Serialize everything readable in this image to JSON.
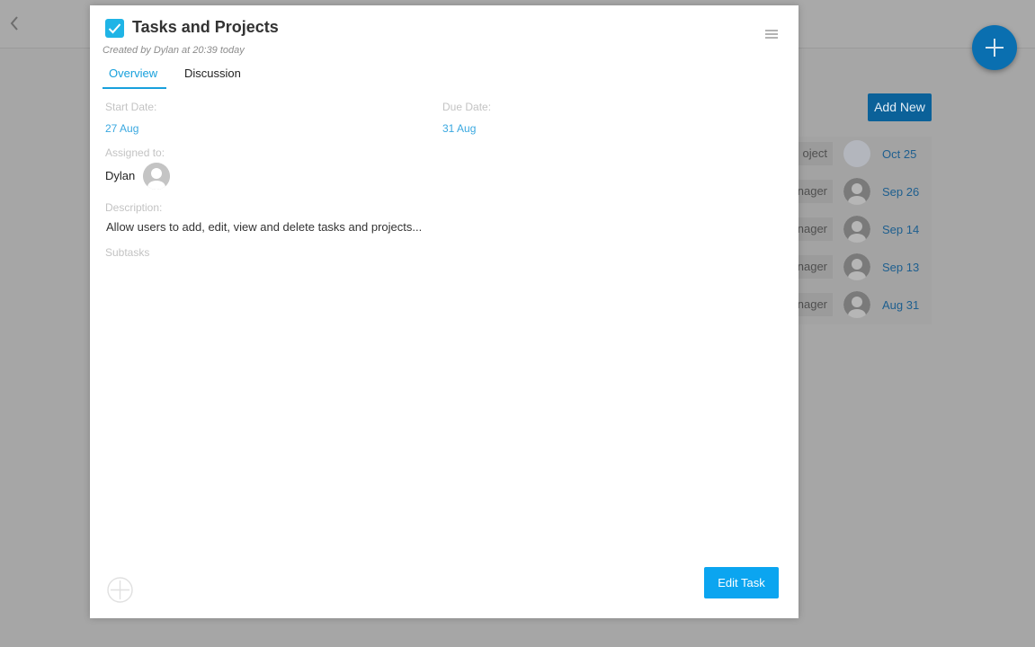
{
  "background": {
    "add_new_label": "Add New",
    "rows": [
      {
        "tag": "oject",
        "date": "Oct 25"
      },
      {
        "tag": "nager",
        "date": "Sep 26"
      },
      {
        "tag": "nager",
        "date": "Sep 14"
      },
      {
        "tag": "nager",
        "date": "Sep 13"
      },
      {
        "tag": "nager",
        "date": "Aug 31"
      }
    ]
  },
  "modal": {
    "title": "Tasks and Projects",
    "created_text": "Created by Dylan at 20:39 today",
    "tabs": [
      {
        "label": "Overview",
        "active": true
      },
      {
        "label": "Discussion",
        "active": false
      }
    ],
    "start_date_label": "Start Date:",
    "start_date": "27 Aug",
    "due_date_label": "Due Date:",
    "due_date": "31 Aug",
    "assigned_label": "Assigned to:",
    "assignee": "Dylan",
    "description_label": "Description:",
    "description": "Allow users to add, edit, view and delete tasks and projects...",
    "subtasks_label": "Subtasks",
    "edit_button": "Edit Task"
  },
  "colors": {
    "accent": "#18a0dc",
    "button": "#0ba5f0",
    "overlay": "#a6a6a6"
  }
}
